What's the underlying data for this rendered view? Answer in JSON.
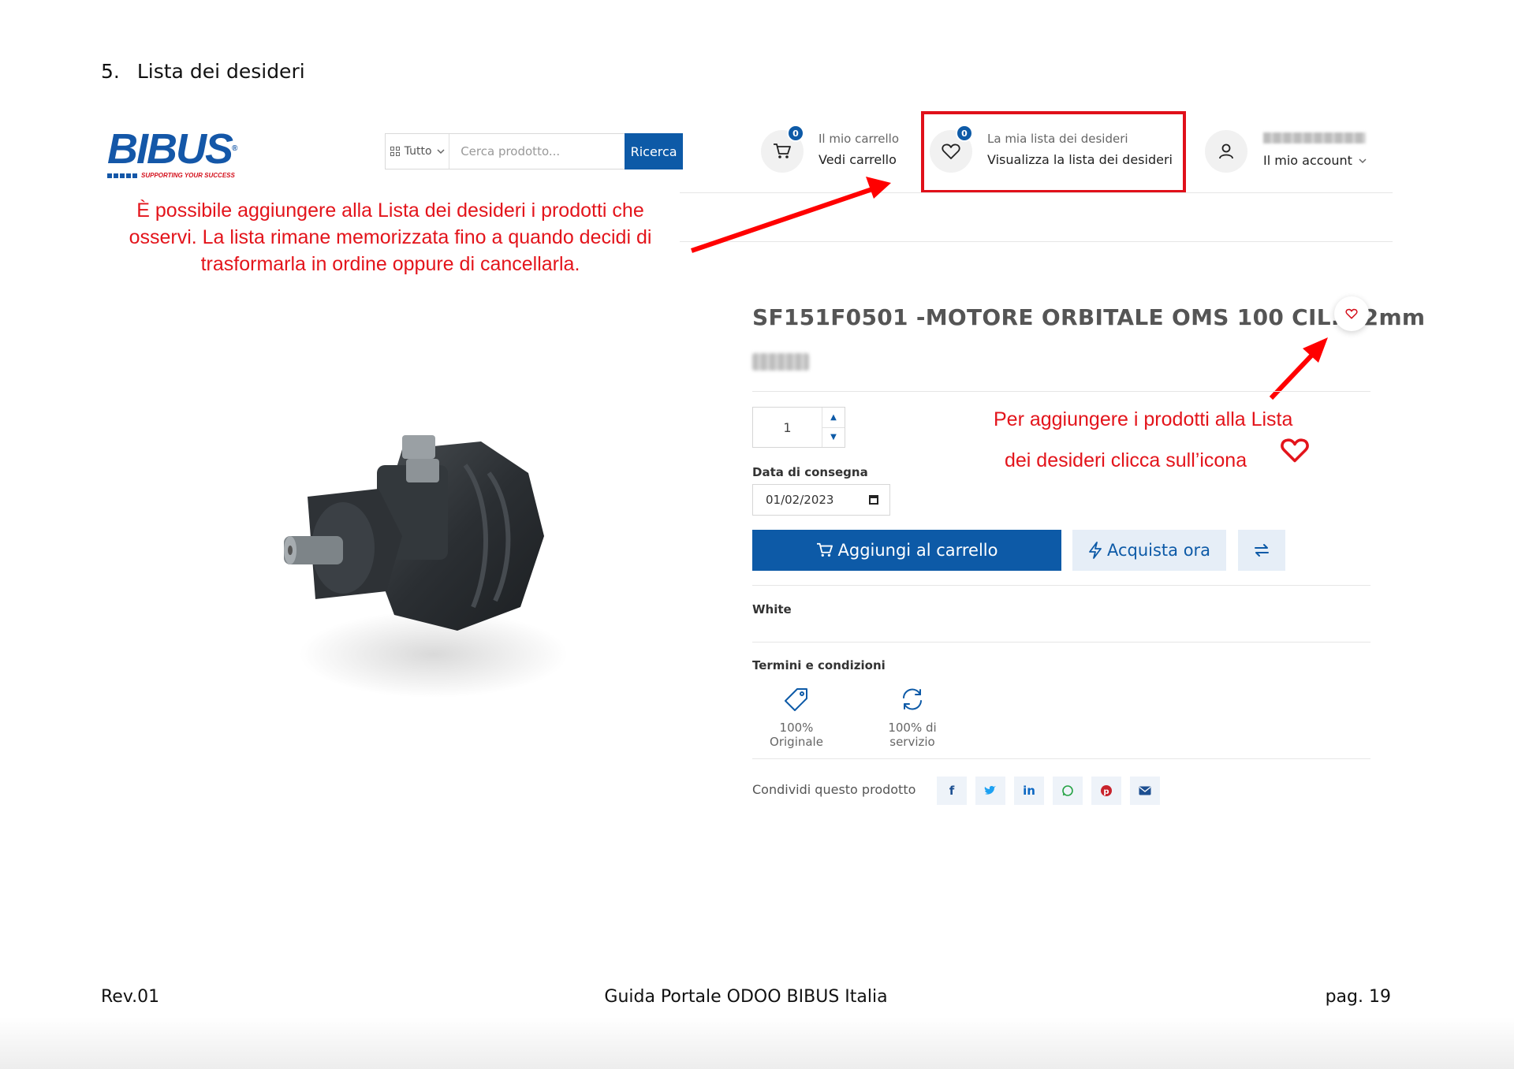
{
  "section": {
    "number": "5.",
    "title": "Lista dei desideri"
  },
  "logo": {
    "brand": "BIBUS",
    "tagline": "SUPPORTING YOUR SUCCESS"
  },
  "search": {
    "category": "Tutto",
    "placeholder": "Cerca prodotto...",
    "button": "Ricerca"
  },
  "header": {
    "cart": {
      "count": "0",
      "small": "Il mio carrello",
      "big": "Vedi carrello"
    },
    "wishlist": {
      "count": "0",
      "small": "La mia lista dei desideri",
      "big": "Visualizza la lista dei desideri"
    },
    "account": {
      "big": "Il mio account"
    }
  },
  "notes": {
    "left": "È possibile aggiungere alla Lista dei desideri i prodotti che osservi. La lista rimane memorizzata fino a quando decidi di trasformarla in ordine oppure di cancellarla.",
    "right_line1": "Per aggiungere i prodotti alla Lista",
    "right_line2": "dei desideri clicca sull’icona"
  },
  "product": {
    "title": "SF151F0501 -MOTORE ORBITALE OMS 100 CIL. 32mm",
    "quantity": "1",
    "delivery_label": "Data di consegna",
    "delivery_date": "01/02/2023",
    "add_to_cart": "Aggiungi al carrello",
    "buy_now": "Acquista ora",
    "variant": "White",
    "terms_title": "Termini e condizioni",
    "terms": [
      "100% Originale",
      "100% di servizio"
    ],
    "share_label": "Condividi questo prodotto"
  },
  "footer": {
    "left": "Rev.01",
    "center": "Guida Portale ODOO BIBUS Italia",
    "right": "pag. 19"
  },
  "colors": {
    "brand_blue": "#0d5aa7",
    "annotation_red": "#e3141b",
    "light_button": "#e6eef7"
  }
}
